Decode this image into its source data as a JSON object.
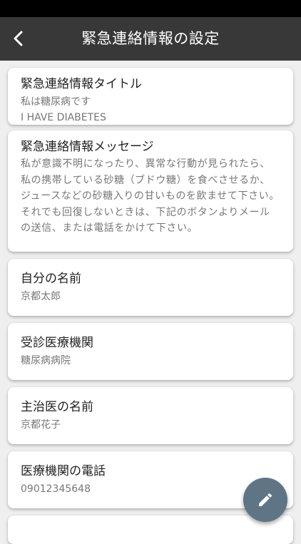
{
  "header": {
    "title": "緊急連絡情報の設定"
  },
  "cards": [
    {
      "title": "緊急連絡情報タイトル",
      "value": "私は糖尿病です\nI HAVE DIABETES"
    },
    {
      "title": "緊急連絡情報メッセージ",
      "value": "私が意識不明になったり、異常な行動が見られたら、私の携帯している砂糖（ブドウ糖）を食べさせるか、ジュースなどの砂糖入りの甘いものを飲ませて下さい。\nそれでも回復しないときは、下記のボタンよりメールの送信、または電話をかけて下さい。"
    },
    {
      "title": "自分の名前",
      "value": "京都太郎"
    },
    {
      "title": "受診医療機関",
      "value": "糖尿病病院"
    },
    {
      "title": "主治医の名前",
      "value": "京都花子"
    },
    {
      "title": "医療機関の電話",
      "value": "09012345648"
    }
  ],
  "icons": {
    "back": "arrow-left-icon",
    "fab": "pencil-icon"
  },
  "colors": {
    "appbar": "#383838",
    "fab": "#5f7586",
    "background": "#efefef"
  }
}
